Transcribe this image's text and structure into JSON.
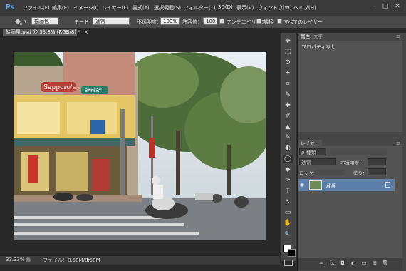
{
  "app": {
    "logo": "Ps"
  },
  "menu": [
    "ファイル(F)",
    "編集(E)",
    "イメージ(I)",
    "レイヤー(L)",
    "書式(Y)",
    "選択範囲(S)",
    "フィルター(T)",
    "3D(D)",
    "表示(V)",
    "ウィンドウ(W)",
    "ヘルプ(H)"
  ],
  "window_controls": {
    "minimize": "–",
    "maximize": "□",
    "close": "✕"
  },
  "options": {
    "tool_preset": "▾",
    "fill_source": "描画色",
    "mode_label": "モード：",
    "mode_value": "通常",
    "opacity_label": "不透明度：",
    "opacity_value": "100%",
    "tolerance_label": "許容値：",
    "tolerance_value": "100",
    "antialias_label": "アンチエイリアス",
    "contiguous_label": "隣接",
    "all_layers_label": "すべてのレイヤー"
  },
  "document": {
    "tab_title": "絵画風.psd @ 33.3% (RGB/8) *",
    "tab_close": "×",
    "shop_sign": "Sapporo's",
    "shop_badge": "BAKERY"
  },
  "status": {
    "zoom": "33.33%",
    "file_info": "ファイル：8.58M/8.58M",
    "arrow": "▶"
  },
  "tools": [
    "✥",
    "⬚",
    "ʘ",
    "✦",
    "⌗",
    "✎",
    "✚",
    "✐",
    "▲",
    "✎",
    "◐",
    "◯",
    "◆",
    "✑",
    "T",
    "↖",
    "▭",
    "✋",
    "🔍"
  ],
  "properties": {
    "tabs": [
      "属性",
      "文字"
    ],
    "content": "プロパティなし"
  },
  "layers": {
    "tab": "レイヤー",
    "filter_kind": "ρ 種類",
    "blend_mode": "通常",
    "opacity_label": "不透明度：",
    "lock_label": "ロック：",
    "fill_label": "塗り：",
    "layer_name": "背景"
  },
  "colors": {
    "accent": "#5b7fa8",
    "ps_blue": "#58a6e8"
  }
}
